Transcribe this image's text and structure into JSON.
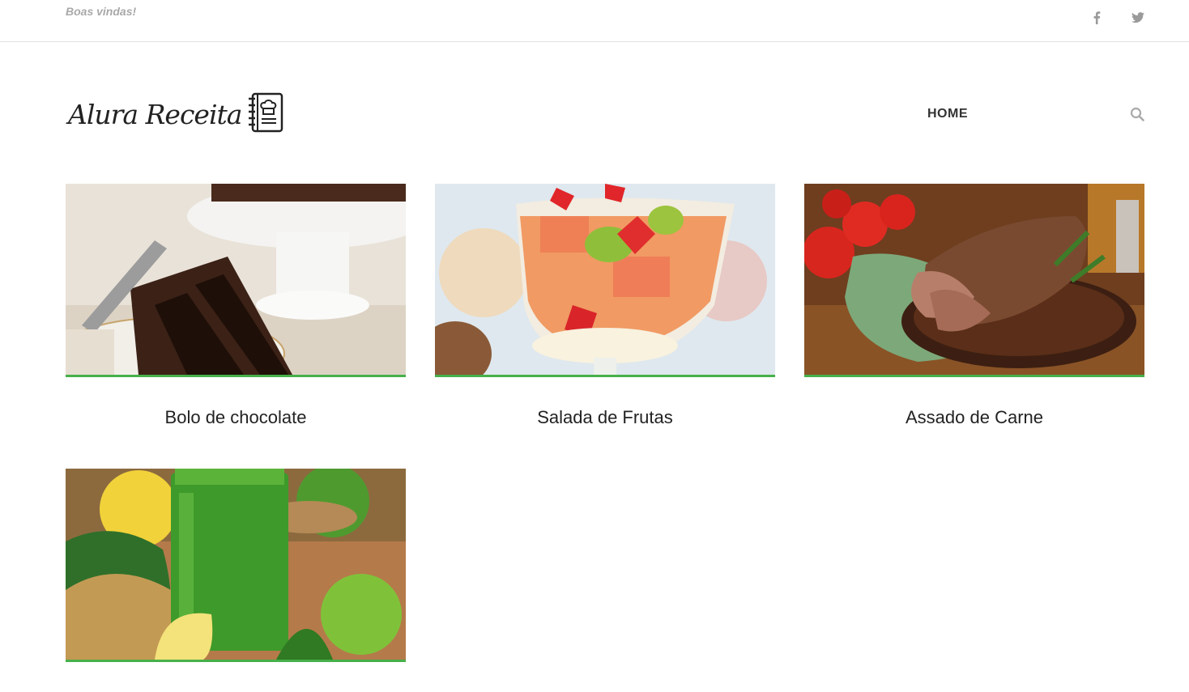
{
  "topbar": {
    "welcome": "Boas vindas!"
  },
  "social": [
    {
      "icon": "facebook-icon"
    },
    {
      "icon": "twitter-icon"
    }
  ],
  "header": {
    "logo_text": "Alura Receita",
    "nav_home": "HOME"
  },
  "accent_color": "#46b04a",
  "recipes": [
    {
      "title": "Bolo de chocolate"
    },
    {
      "title": "Salada de Frutas"
    },
    {
      "title": "Assado de Carne"
    },
    {
      "title": ""
    }
  ]
}
